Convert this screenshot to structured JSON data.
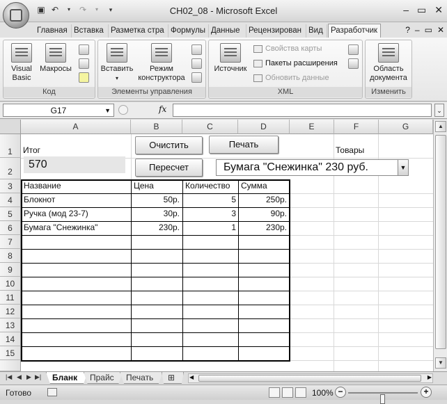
{
  "window": {
    "title": "CH02_08 - Microsoft Excel",
    "qat_icons": [
      "save-icon",
      "undo-icon",
      "redo-icon",
      "customize-icon"
    ],
    "controls": {
      "minimize": "–",
      "restore": "▭",
      "close": "✕"
    }
  },
  "ribbon": {
    "tabs": [
      {
        "label": "Главная",
        "active": false
      },
      {
        "label": "Вставка",
        "active": false
      },
      {
        "label": "Разметка стра",
        "active": false
      },
      {
        "label": "Формулы",
        "active": false
      },
      {
        "label": "Данные",
        "active": false
      },
      {
        "label": "Рецензирован",
        "active": false
      },
      {
        "label": "Вид",
        "active": false
      },
      {
        "label": "Разработчик",
        "active": true
      }
    ],
    "groups": {
      "code": {
        "label": "Код",
        "visual_basic_line1": "Visual",
        "visual_basic_line2": "Basic",
        "macros": "Макросы"
      },
      "controls": {
        "label": "Элементы управления",
        "insert": "Вставить",
        "design_mode_line1": "Режим",
        "design_mode_line2": "конструктора"
      },
      "xml": {
        "label": "XML",
        "source": "Источник",
        "map_properties": "Свойства карты",
        "expansion_packs": "Пакеты расширения",
        "refresh_data": "Обновить данные"
      },
      "modify": {
        "label": "Изменить",
        "doc_panel_line1": "Область",
        "doc_panel_line2": "документа"
      }
    }
  },
  "formula_bar": {
    "name_box": "G17",
    "fx": "fx",
    "formula": ""
  },
  "grid": {
    "columns": [
      "A",
      "B",
      "C",
      "D",
      "E",
      "F",
      "G"
    ],
    "rows": [
      "1",
      "2",
      "3",
      "4",
      "5",
      "6",
      "7",
      "8",
      "9",
      "10",
      "11",
      "12",
      "13",
      "14",
      "15"
    ]
  },
  "sheet": {
    "itog_label": "Итог",
    "itog_value": "570",
    "buttons": {
      "clear": "Очистить",
      "print": "Печать",
      "recalc": "Пересчет"
    },
    "goods_label": "Товары",
    "goods_selected": "Бумага \"Снежинка\"  230 руб.",
    "table": {
      "headers": [
        "Название",
        "Цена",
        "Количество",
        "Сумма"
      ],
      "rows": [
        [
          "Блокнот",
          "50р.",
          "5",
          "250р."
        ],
        [
          "Ручка (мод 23-7)",
          "30р.",
          "3",
          "90р."
        ],
        [
          "Бумага \"Снежинка\"",
          "230р.",
          "1",
          "230р."
        ]
      ]
    }
  },
  "sheet_tabs": [
    {
      "label": "Бланк",
      "active": true
    },
    {
      "label": "Прайс",
      "active": false
    },
    {
      "label": "Печать",
      "active": false
    }
  ],
  "status": {
    "ready": "Готово",
    "zoom": "100%",
    "zoom_level": 1.0
  }
}
